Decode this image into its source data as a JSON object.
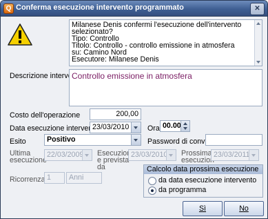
{
  "window": {
    "title": "Conferma esecuzione intervento programmato",
    "app_icon_glyph": "Q",
    "close_glyph": "✕"
  },
  "message": {
    "lines": [
      "Milanese Denis confermi l'esecuzione dell'intervento selezionato?",
      "Tipo: Controllo",
      "Titolo: Controllo - controllo emissione in atmosfera",
      "su: Camino Nord",
      "Esecutore: Milanese Denis"
    ]
  },
  "form": {
    "descrizione_label": "Descrizione intervento",
    "descrizione_value": "Controllo emissione in atmosfera",
    "costo_label": "Costo dell'operazione",
    "costo_value": "200,00",
    "data_label": "Data esecuzione intervento",
    "data_value": "23/03/2010",
    "ora_label": "Ora",
    "ora_value": "00.00",
    "esito_label": "Esito",
    "esito_value": "Positivo",
    "password_label": "Password di convalida",
    "password_value": "",
    "ultima_label": "Ultima\nesecuzione",
    "ultima_value": "22/03/2009",
    "prevista_label": "Esecuzion\ne prevista\nda",
    "prevista_value": "23/03/2010",
    "prossima_label": "Prossima\nesecuzion",
    "prossima_value": "23/03/2011",
    "ricorrenza_label": "Ricorrenza",
    "ricorrenza_value": "1",
    "ricorrenza_unit": "Anni"
  },
  "calcolo": {
    "title": "Calcolo data prossima esecuzione",
    "options": [
      "da data esecuzione intervento",
      "da programma"
    ],
    "selected": 1
  },
  "buttons": {
    "si": "Sì",
    "no": "No"
  },
  "colors": {
    "title_bar": "#3f5f93",
    "description_text": "#7a1d63",
    "warning": "#f5d000"
  },
  "icons": {
    "warning": "warning-icon",
    "close": "close-icon",
    "app": "app-icon"
  }
}
